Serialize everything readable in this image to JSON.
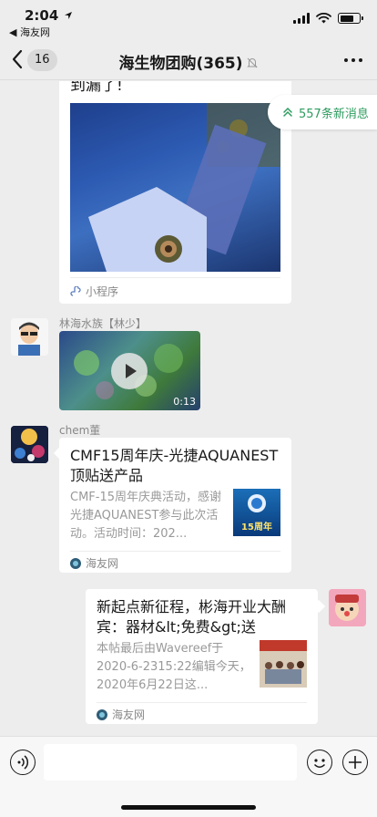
{
  "status_bar": {
    "time": "2:04",
    "back_app": "◀ 海友网",
    "battery_level": 0.7
  },
  "nav": {
    "back_count": "16",
    "title": "海生物团购(365)"
  },
  "new_messages": {
    "label": "557条新消息"
  },
  "messages": [
    {
      "type": "mini_program",
      "title_tail": "到漏了!",
      "source": "小程序"
    },
    {
      "type": "video",
      "sender": "林海水族【林少】",
      "duration": "0:13"
    },
    {
      "type": "link_card",
      "sender": "chem董",
      "title": "CMF15周年庆-光捷AQUANEST顶贴送产品",
      "desc": "CMF-15周年庆典活动，感谢光捷AQUANEST参与此次活动。活动时间：202...",
      "thumb_text": "15周年",
      "source": "海友网"
    },
    {
      "type": "link_card",
      "sender": "",
      "title": "新起点新征程，彬海开业大酬宾：器材&lt;免费&gt;送",
      "desc": "本帖最后由Wavereef于2020-6-2315:22编辑今天，2020年6月22日这...",
      "source": "海友网"
    }
  ],
  "colors": {
    "accent_green": "#2e9c5f",
    "background": "#ededed"
  }
}
